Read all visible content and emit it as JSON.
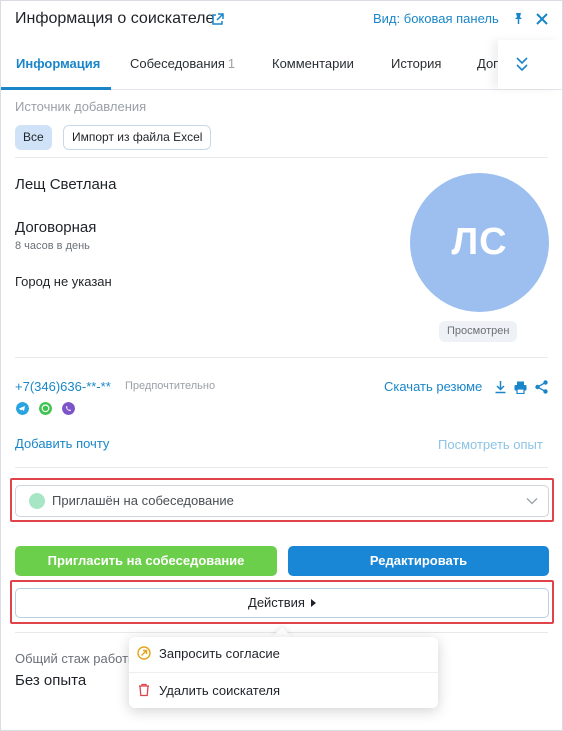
{
  "header": {
    "title": "Информация о соискателе",
    "view_mode": "Вид: боковая панель"
  },
  "tabs": [
    {
      "label": "Информация",
      "active": true
    },
    {
      "label": "Собеседования",
      "count": "1"
    },
    {
      "label": "Комментарии"
    },
    {
      "label": "История"
    },
    {
      "label": "Доп"
    }
  ],
  "source": {
    "label": "Источник добавления",
    "chips": [
      "Все",
      "Импорт из файла Excel"
    ]
  },
  "candidate": {
    "name": "Лещ Светлана",
    "salary": "Договорная",
    "hours": "8 часов в день",
    "city": "Город не указан",
    "initials": "ЛС",
    "viewed_badge": "Просмотрен"
  },
  "contacts": {
    "phone": "+7(346)636-**-**",
    "preferred": "Предпочтительно",
    "messengers": [
      "telegram-icon",
      "whatsapp-icon",
      "viber-icon"
    ],
    "download_resume": "Скачать резюме",
    "add_email": "Добавить почту",
    "view_experience": "Посмотреть опыт"
  },
  "status": {
    "value": "Приглашён на собеседование",
    "dot_color": "#a7e6c4"
  },
  "buttons": {
    "invite": "Пригласить на собеседование",
    "edit": "Редактировать",
    "actions": "Действия"
  },
  "experience": {
    "label": "Общий стаж работы",
    "value": "Без опыта"
  },
  "actions_menu": [
    {
      "label": "Запросить согласие",
      "icon": "request-consent-icon"
    },
    {
      "label": "Удалить соискателя",
      "icon": "trash-icon"
    }
  ],
  "colors": {
    "accent": "#1a86c9",
    "invite_button": "#6ccf4b",
    "edit_button": "#1a86d6",
    "avatar": "#9dbff0",
    "highlight": "#e0434a"
  }
}
